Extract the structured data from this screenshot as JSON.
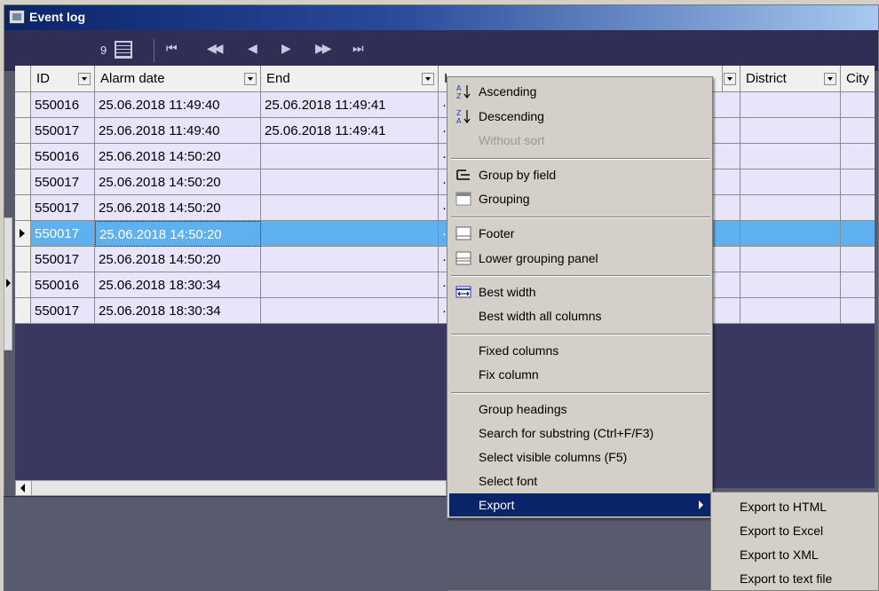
{
  "window": {
    "title": "Event log"
  },
  "toolbar": {
    "record_count": "9",
    "nav_first": "⏮",
    "nav_prev_page": "◀◀",
    "nav_prev": "◀",
    "nav_next": "▶",
    "nav_next_page": "▶▶",
    "nav_last": "⏭"
  },
  "columns": [
    {
      "label": "ID"
    },
    {
      "label": "Alarm date"
    },
    {
      "label": "End"
    },
    {
      "label": "I"
    },
    {
      "label": ""
    },
    {
      "label": "District"
    },
    {
      "label": "City"
    }
  ],
  "rows": [
    {
      "id": "550016",
      "alarm_date": "25.06.2018 11:49:40",
      "end": "25.06.2018 11:49:41",
      "trunc": "·"
    },
    {
      "id": "550017",
      "alarm_date": "25.06.2018 11:49:40",
      "end": "25.06.2018 11:49:41",
      "trunc": "·"
    },
    {
      "id": "550016",
      "alarm_date": "25.06.2018 14:50:20",
      "end": "",
      "trunc": "·"
    },
    {
      "id": "550017",
      "alarm_date": "25.06.2018 14:50:20",
      "end": "",
      "trunc": "·"
    },
    {
      "id": "550017",
      "alarm_date": "25.06.2018 14:50:20",
      "end": "",
      "trunc": "·"
    },
    {
      "id": "550017",
      "alarm_date": "25.06.2018 14:50:20",
      "end": "",
      "trunc": "·",
      "selected": true
    },
    {
      "id": "550017",
      "alarm_date": "25.06.2018 14:50:20",
      "end": "",
      "trunc": "·"
    },
    {
      "id": "550016",
      "alarm_date": "25.06.2018 18:30:34",
      "end": "",
      "trunc": "·"
    },
    {
      "id": "550017",
      "alarm_date": "25.06.2018 18:30:34",
      "end": "",
      "trunc": "·"
    }
  ],
  "context_menu": {
    "ascending": "Ascending",
    "descending": "Descending",
    "without_sort": "Without sort",
    "group_by_field": "Group by field",
    "grouping": "Grouping",
    "footer": "Footer",
    "lower_grouping_panel": "Lower grouping panel",
    "best_width": "Best width",
    "best_width_all": "Best width all columns",
    "fixed_columns": "Fixed columns",
    "fix_column": "Fix column",
    "group_headings": "Group headings",
    "search_substring": "Search for substring (Ctrl+F/F3)",
    "select_visible_columns": "Select visible columns (F5)",
    "select_font": "Select font",
    "export": "Export"
  },
  "export_submenu": {
    "html": "Export to HTML",
    "excel": "Export to Excel",
    "xml": "Export to XML",
    "text": "Export to text file"
  },
  "colors": {
    "row_bg": "#e8e4fa",
    "selected_bg": "#5fb0ee",
    "menu_highlight": "#0a246a",
    "grid_empty_bg": "#383860"
  }
}
